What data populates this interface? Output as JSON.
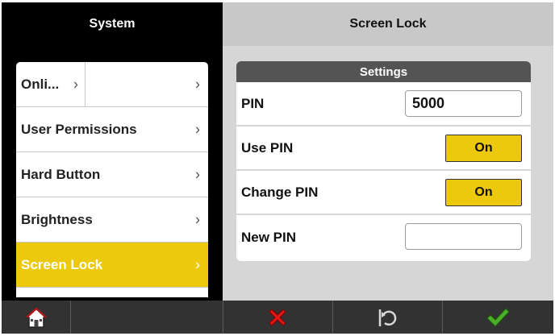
{
  "left_panel": {
    "title": "System",
    "items": [
      {
        "label": "Onli...",
        "split": true
      },
      {
        "label": "User Permissions"
      },
      {
        "label": "Hard Button"
      },
      {
        "label": "Brightness"
      },
      {
        "label": "Screen Lock",
        "active": true
      }
    ]
  },
  "right_panel": {
    "title": "Screen Lock",
    "settings_title": "Settings",
    "rows": {
      "pin": {
        "label": "PIN",
        "value": "5000"
      },
      "use_pin": {
        "label": "Use PIN",
        "value": "On"
      },
      "change_pin": {
        "label": "Change PIN",
        "value": "On"
      },
      "new_pin": {
        "label": "New PIN",
        "value": ""
      }
    }
  },
  "toolbar": {
    "icons": [
      "home-icon",
      "cancel-x-icon",
      "reset-icon",
      "confirm-check-icon"
    ]
  },
  "colors": {
    "accent_yellow": "#ecc90d",
    "header_dark": "#000000",
    "header_light": "#c8c8c8",
    "panel_bg": "#d6d6d6",
    "bottom_bar": "#323232",
    "cancel_red": "#e01818",
    "confirm_green": "#4caf28"
  }
}
